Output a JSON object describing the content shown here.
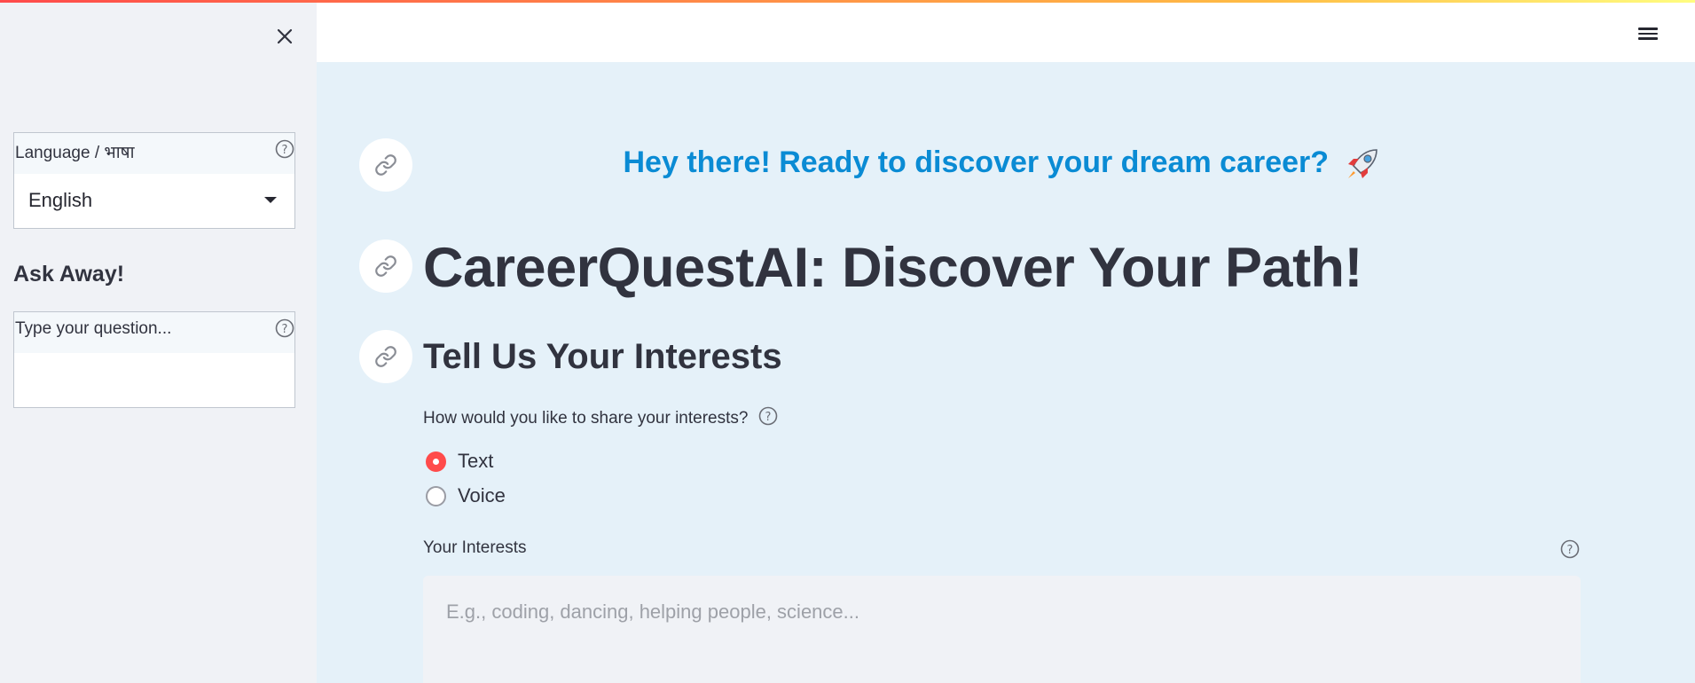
{
  "sidebar": {
    "language_label": "Language / भाषा",
    "language_value": "English",
    "ask_heading": "Ask Away!",
    "question_label": "Type your question..."
  },
  "main": {
    "tagline": "Hey there! Ready to discover your dream career?",
    "title": "CareerQuestAI: Discover Your Path!",
    "subheading": "Tell Us Your Interests",
    "share_label": "How would you like to share your interests?",
    "radio_options": [
      {
        "label": "Text",
        "selected": true
      },
      {
        "label": "Voice",
        "selected": false
      }
    ],
    "interests_label": "Your Interests",
    "interests_placeholder": "E.g., coding, dancing, helping people, science..."
  },
  "colors": {
    "accent": "#ff4b4b",
    "tagline": "#0a8bd4",
    "background": "#e5f1f9",
    "sidebar": "#f0f2f6"
  },
  "icons": [
    "close-icon",
    "help-icon",
    "chevron-down-icon",
    "link-icon",
    "menu-icon",
    "rocket-icon"
  ]
}
